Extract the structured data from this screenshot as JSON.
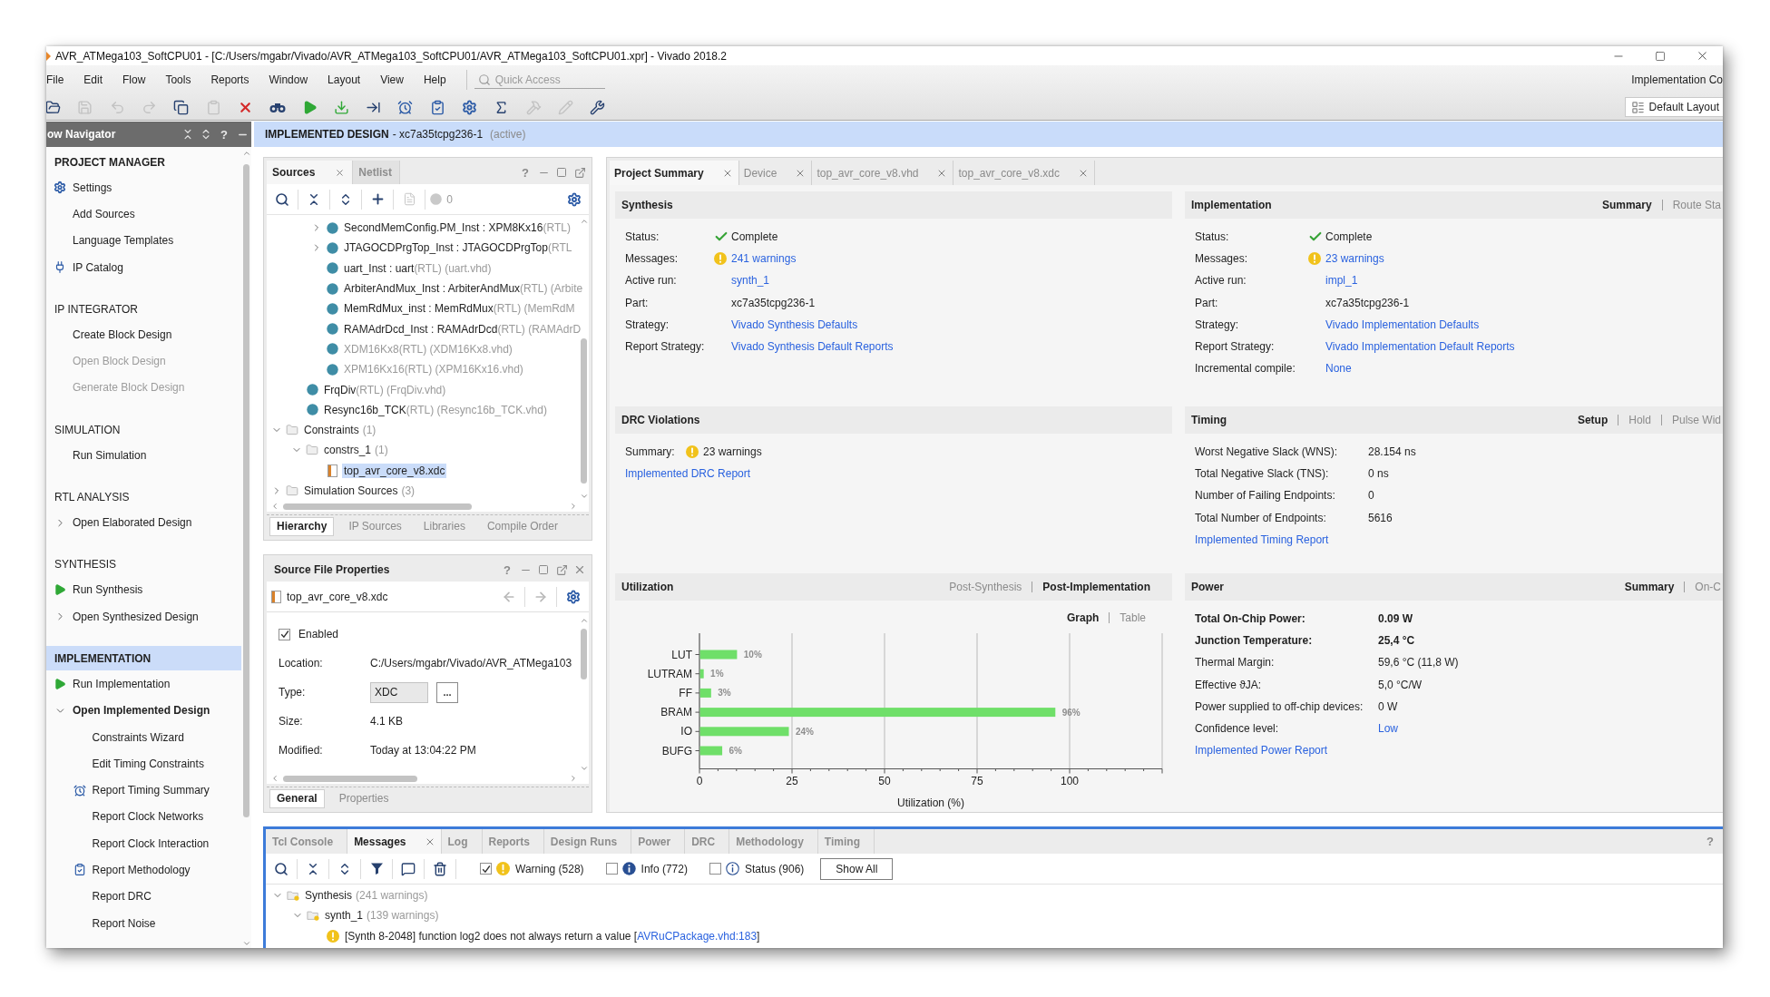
{
  "window": {
    "title": "AVR_ATMega103_SoftCPU01 - [C:/Users/mgabr/Vivado/AVR_ATMega103_SoftCPU01/AVR_ATMega103_SoftCPU01.xpr] - Vivado 2018.2"
  },
  "menu": [
    "File",
    "Edit",
    "Flow",
    "Tools",
    "Reports",
    "Window",
    "Layout",
    "View",
    "Help"
  ],
  "quick_access": {
    "placeholder": "Quick Access"
  },
  "run_status": "Implementation Co",
  "toolbar": [
    {
      "kind": "open",
      "disabled": false
    },
    {
      "kind": "save",
      "disabled": true
    },
    {
      "kind": "undo",
      "disabled": true
    },
    {
      "kind": "redo",
      "disabled": true
    },
    {
      "kind": "copy",
      "disabled": false
    },
    {
      "kind": "paste",
      "disabled": true
    },
    {
      "kind": "delete",
      "disabled": false
    },
    {
      "kind": "find",
      "disabled": false
    },
    {
      "kind": "run",
      "disabled": false
    },
    {
      "kind": "program",
      "disabled": false
    },
    {
      "kind": "jump",
      "disabled": false
    },
    {
      "kind": "timer",
      "disabled": false
    },
    {
      "kind": "checklist",
      "disabled": false
    },
    {
      "kind": "settings",
      "disabled": false
    },
    {
      "kind": "sum",
      "disabled": false
    },
    {
      "kind": "hammer",
      "disabled": true
    },
    {
      "kind": "pencil",
      "disabled": true
    },
    {
      "kind": "wrench",
      "disabled": false
    }
  ],
  "layout_button": {
    "label": "Default Layout"
  },
  "flow_navigator": {
    "title": "ow Navigator",
    "help": "?",
    "sections": [
      {
        "title": "PROJECT MANAGER",
        "current": true,
        "selected": false,
        "items": [
          {
            "label": "Settings",
            "kind": "settings",
            "disabled": false,
            "current": false
          },
          {
            "label": "Add Sources",
            "kind": "plain",
            "disabled": false,
            "current": false
          },
          {
            "label": "Language Templates",
            "kind": "plain",
            "disabled": false,
            "current": false
          },
          {
            "label": "IP Catalog",
            "kind": "ip",
            "disabled": false,
            "current": false
          }
        ]
      },
      {
        "title": "IP INTEGRATOR",
        "current": false,
        "selected": false,
        "items": [
          {
            "label": "Create Block Design",
            "kind": "plain",
            "disabled": false,
            "current": false
          },
          {
            "label": "Open Block Design",
            "kind": "plain",
            "disabled": true,
            "current": false
          },
          {
            "label": "Generate Block Design",
            "kind": "plain",
            "disabled": true,
            "current": false
          }
        ]
      },
      {
        "title": "SIMULATION",
        "current": false,
        "selected": false,
        "items": [
          {
            "label": "Run Simulation",
            "kind": "plain",
            "disabled": false,
            "current": false
          }
        ]
      },
      {
        "title": "RTL ANALYSIS",
        "current": false,
        "selected": false,
        "items": [
          {
            "label": "Open Elaborated Design",
            "kind": "group",
            "expanded": false,
            "disabled": false,
            "current": false
          }
        ]
      },
      {
        "title": "SYNTHESIS",
        "current": false,
        "selected": false,
        "items": [
          {
            "label": "Run Synthesis",
            "kind": "run",
            "disabled": false,
            "current": false
          },
          {
            "label": "Open Synthesized Design",
            "kind": "group",
            "expanded": false,
            "disabled": false,
            "current": false
          }
        ]
      },
      {
        "title": "IMPLEMENTATION",
        "current": true,
        "selected": true,
        "items": [
          {
            "label": "Run Implementation",
            "kind": "run",
            "disabled": false,
            "current": false
          },
          {
            "label": "Open Implemented Design",
            "kind": "group",
            "expanded": true,
            "disabled": false,
            "current": true,
            "children": [
              {
                "label": "Constraints Wizard",
                "kind": "plain",
                "disabled": false,
                "current": false
              },
              {
                "label": "Edit Timing Constraints",
                "kind": "plain",
                "disabled": false,
                "current": false
              },
              {
                "label": "Report Timing Summary",
                "kind": "timer",
                "disabled": false,
                "current": false
              },
              {
                "label": "Report Clock Networks",
                "kind": "plain",
                "disabled": false,
                "current": false
              },
              {
                "label": "Report Clock Interaction",
                "kind": "plain",
                "disabled": false,
                "current": false
              },
              {
                "label": "Report Methodology",
                "kind": "checklist",
                "disabled": false,
                "current": false
              },
              {
                "label": "Report DRC",
                "kind": "plain",
                "disabled": false,
                "current": false
              },
              {
                "label": "Report Noise",
                "kind": "plain",
                "disabled": false,
                "current": false
              }
            ]
          }
        ]
      }
    ]
  },
  "design_banner": {
    "title": "IMPLEMENTED DESIGN",
    "part": "- xc7a35tcpg236-1",
    "state": "(active)"
  },
  "sources": {
    "tabs": [
      {
        "label": "Sources",
        "selected": true,
        "closable": true
      },
      {
        "label": "Netlist",
        "selected": false,
        "closable": false
      }
    ],
    "help": "?",
    "count": "0",
    "tree": [
      {
        "kind": "hidden",
        "children": [
          {
            "kind": "hidden",
            "children": [
              {
                "kind": "module",
                "name": "SecondMemConfig.PM_Inst : XPM8Kx16",
                "detail": "(RTL)",
                "expanded": false,
                "greyed": false,
                "selected": false
              },
              {
                "kind": "module",
                "name": "JTAGOCDPrgTop_Inst : JTAGOCDPrgTop",
                "detail": "(RTL",
                "expanded": false,
                "greyed": false,
                "selected": false
              },
              {
                "kind": "module",
                "name": "uart_Inst : uart",
                "detail": "(RTL) (uart.vhd)",
                "greyed": false,
                "selected": false
              },
              {
                "kind": "module",
                "name": "ArbiterAndMux_Inst : ArbiterAndMux",
                "detail": "(RTL) (Arbite",
                "greyed": false,
                "selected": false
              },
              {
                "kind": "module",
                "name": "MemRdMux_inst : MemRdMux",
                "detail": "(RTL) (MemRdM",
                "greyed": false,
                "selected": false
              },
              {
                "kind": "module",
                "name": "RAMAdrDcd_Inst : RAMAdrDcd",
                "detail": "(RTL) (RAMAdrD",
                "greyed": false,
                "selected": false
              },
              {
                "kind": "module",
                "name": "XDM16Kx8",
                "detail": "(RTL) (XDM16Kx8.vhd)",
                "greyed": true,
                "selected": false
              },
              {
                "kind": "module",
                "name": "XPM16Kx16",
                "detail": "(RTL) (XPM16Kx16.vhd)",
                "greyed": true,
                "selected": false
              }
            ]
          },
          {
            "kind": "module",
            "name": "FrqDiv",
            "detail": "(RTL) (FrqDiv.vhd)",
            "greyed": false,
            "selected": false
          },
          {
            "kind": "module",
            "name": "Resync16b_TCK",
            "detail": "(RTL) (Resync16b_TCK.vhd)",
            "greyed": false,
            "selected": false
          }
        ]
      },
      {
        "kind": "folder",
        "name": "Constraints",
        "detail": "(1)",
        "expanded": true,
        "selected": false,
        "children": [
          {
            "kind": "folder",
            "name": "constrs_1",
            "detail": "(1)",
            "expanded": true,
            "selected": false,
            "children": [
              {
                "kind": "file",
                "name": "top_avr_core_v8.xdc",
                "selected": true
              }
            ]
          }
        ]
      },
      {
        "kind": "folder",
        "name": "Simulation Sources",
        "detail": "(3)",
        "expanded": false,
        "selected": false
      }
    ],
    "bottom_tabs": [
      {
        "label": "Hierarchy",
        "selected": true
      },
      {
        "label": "IP Sources",
        "selected": false
      },
      {
        "label": "Libraries",
        "selected": false
      },
      {
        "label": "Compile Order",
        "selected": false
      }
    ]
  },
  "file_properties": {
    "title": "Source File Properties",
    "help": "?",
    "file": "top_avr_core_v8.xdc",
    "enabled": {
      "label": "Enabled",
      "checked": true
    },
    "fields": [
      {
        "kind": "text",
        "label": "Location:",
        "value": "C:/Users/mgabr/Vivado/AVR_ATMega103"
      },
      {
        "kind": "field",
        "label": "Type:",
        "value": "XDC",
        "button": "..."
      },
      {
        "kind": "text",
        "label": "Size:",
        "value": "4.1 KB"
      },
      {
        "kind": "text",
        "label": "Modified:",
        "value": "Today at 13:04:22 PM"
      }
    ],
    "tabs": [
      {
        "label": "General",
        "selected": true
      },
      {
        "label": "Properties",
        "selected": false
      }
    ]
  },
  "summary": {
    "tabs": [
      {
        "label": "Project Summary",
        "selected": true
      },
      {
        "label": "Device",
        "selected": false
      },
      {
        "label": "top_avr_core_v8.vhd",
        "selected": false
      },
      {
        "label": "top_avr_core_v8.xdc",
        "selected": false
      }
    ],
    "sections": [
      {
        "kind": "rows",
        "title": "Synthesis",
        "rows": [
          {
            "kind": "complete",
            "label": "Status:",
            "value": "Complete",
            "link": false
          },
          {
            "kind": "warnings",
            "label": "Messages:",
            "value": "241 warnings",
            "link": true
          },
          {
            "kind": "plain",
            "label": "Active run:",
            "value": "synth_1",
            "link": true
          },
          {
            "kind": "plain",
            "label": "Part:",
            "value": "xc7a35tcpg236-1",
            "link": false
          },
          {
            "kind": "plain",
            "label": "Strategy:",
            "value": "Vivado Synthesis Defaults",
            "link": true
          },
          {
            "kind": "plain",
            "label": "Report Strategy:",
            "value": "Vivado Synthesis Default Reports",
            "link": true
          }
        ]
      },
      {
        "kind": "rows",
        "title": "Implementation",
        "views": [
          {
            "label": "Summary",
            "selected": true
          },
          {
            "label": "Route Sta",
            "selected": false
          }
        ],
        "rows": [
          {
            "kind": "complete",
            "label": "Status:",
            "value": "Complete",
            "link": false
          },
          {
            "kind": "warnings",
            "label": "Messages:",
            "value": "23 warnings",
            "link": true
          },
          {
            "kind": "plain",
            "label": "Active run:",
            "value": "impl_1",
            "link": true
          },
          {
            "kind": "plain",
            "label": "Part:",
            "value": "xc7a35tcpg236-1",
            "link": false
          },
          {
            "kind": "plain",
            "label": "Strategy:",
            "value": "Vivado Implementation Defaults",
            "link": true
          },
          {
            "kind": "plain",
            "label": "Report Strategy:",
            "value": "Vivado Implementation Default Reports",
            "link": true
          },
          {
            "kind": "plain",
            "label": "Incremental compile:",
            "value": "None",
            "link": true
          }
        ]
      },
      {
        "kind": "rows",
        "title": "DRC Violations",
        "rows": [
          {
            "kind": "warnings",
            "label": "Summary:",
            "value": "23 warnings",
            "link": false
          }
        ],
        "report_link": "Implemented DRC Report"
      },
      {
        "kind": "rows",
        "title": "Timing",
        "views": [
          {
            "label": "Setup",
            "selected": true
          },
          {
            "label": "Hold",
            "selected": false
          },
          {
            "label": "Pulse Wid",
            "selected": false
          }
        ],
        "rows": [
          {
            "label": "Worst Negative Slack (WNS):",
            "value": "28.154 ns",
            "link": false
          },
          {
            "label": "Total Negative Slack (TNS):",
            "value": "0 ns",
            "link": false
          },
          {
            "label": "Number of Failing Endpoints:",
            "value": "0",
            "link": false
          },
          {
            "label": "Total Number of Endpoints:",
            "value": "5616",
            "link": false
          }
        ],
        "report_link": "Implemented Timing Report"
      },
      {
        "kind": "chart",
        "title": "Utilization",
        "views": [
          {
            "label": "Post-Synthesis",
            "selected": false
          },
          {
            "label": "Post-Implementation",
            "selected": true
          }
        ],
        "modes": [
          {
            "label": "Graph",
            "selected": true
          },
          {
            "label": "Table",
            "selected": false
          }
        ],
        "chart_data": {
          "type": "bar",
          "orientation": "horizontal",
          "grid": true,
          "xlabel": "Utilization (%)",
          "categories": [
            "LUT",
            "LUTRAM",
            "FF",
            "BRAM",
            "IO",
            "BUFG"
          ],
          "values": [
            10,
            1,
            3,
            96,
            24,
            6
          ],
          "xlim": [
            0,
            125
          ],
          "xticks": [
            0,
            25,
            50,
            75,
            100
          ],
          "value_labels": [
            "10%",
            "1%",
            "3%",
            "96%",
            "24%",
            "6%"
          ]
        }
      },
      {
        "kind": "rows",
        "title": "Power",
        "views": [
          {
            "label": "Summary",
            "selected": true
          },
          {
            "label": "On-C",
            "selected": false
          }
        ],
        "rows": [
          {
            "label": "Total On-Chip Power:",
            "value": "0.09 W",
            "bold": true,
            "link": false
          },
          {
            "label": "Junction Temperature:",
            "value": "25,4 °C",
            "bold": true,
            "link": false
          },
          {
            "label": "Thermal Margin:",
            "value": "59,6 °C (11,8 W)",
            "bold": false,
            "link": false
          },
          {
            "label": "Effective ϑJA:",
            "value": "5,0 °C/W",
            "bold": false,
            "link": false
          },
          {
            "label": "Power supplied to off-chip devices:",
            "value": "0 W",
            "bold": false,
            "link": false
          },
          {
            "label": "Confidence level:",
            "value": "Low",
            "bold": false,
            "link": true
          }
        ],
        "report_link": "Implemented Power Report"
      }
    ]
  },
  "messages": {
    "tabs": [
      {
        "label": "Tcl Console",
        "selected": false,
        "closable": false
      },
      {
        "label": "Messages",
        "selected": true,
        "closable": true
      },
      {
        "label": "Log",
        "selected": false,
        "closable": false
      },
      {
        "label": "Reports",
        "selected": false,
        "closable": false
      },
      {
        "label": "Design Runs",
        "selected": false,
        "closable": false
      },
      {
        "label": "Power",
        "selected": false,
        "closable": false
      },
      {
        "label": "DRC",
        "selected": false,
        "closable": false
      },
      {
        "label": "Methodology",
        "selected": false,
        "closable": false
      },
      {
        "label": "Timing",
        "selected": false,
        "closable": false
      }
    ],
    "help": "?",
    "filters": [
      {
        "kind": "warning",
        "label": "Warning (528)",
        "checked": true
      },
      {
        "kind": "info",
        "label": "Info (772)",
        "checked": false
      },
      {
        "kind": "status",
        "label": "Status (906)",
        "checked": false
      }
    ],
    "show_all": "Show All",
    "tree": [
      {
        "kind": "log_folder",
        "name": "Synthesis",
        "detail": "(241 warnings)",
        "expanded": true,
        "selected": false,
        "children": [
          {
            "kind": "log_folder",
            "name": "synth_1",
            "detail": "(139 warnings)",
            "expanded": true,
            "selected": false,
            "children": [
              {
                "kind": "message",
                "text": "[Synth 8-2048] function log2 does not always return a value [",
                "link": "AVRuCPackage.vhd:183",
                "suffix": "]",
                "selected": false
              }
            ]
          }
        ]
      }
    ]
  }
}
